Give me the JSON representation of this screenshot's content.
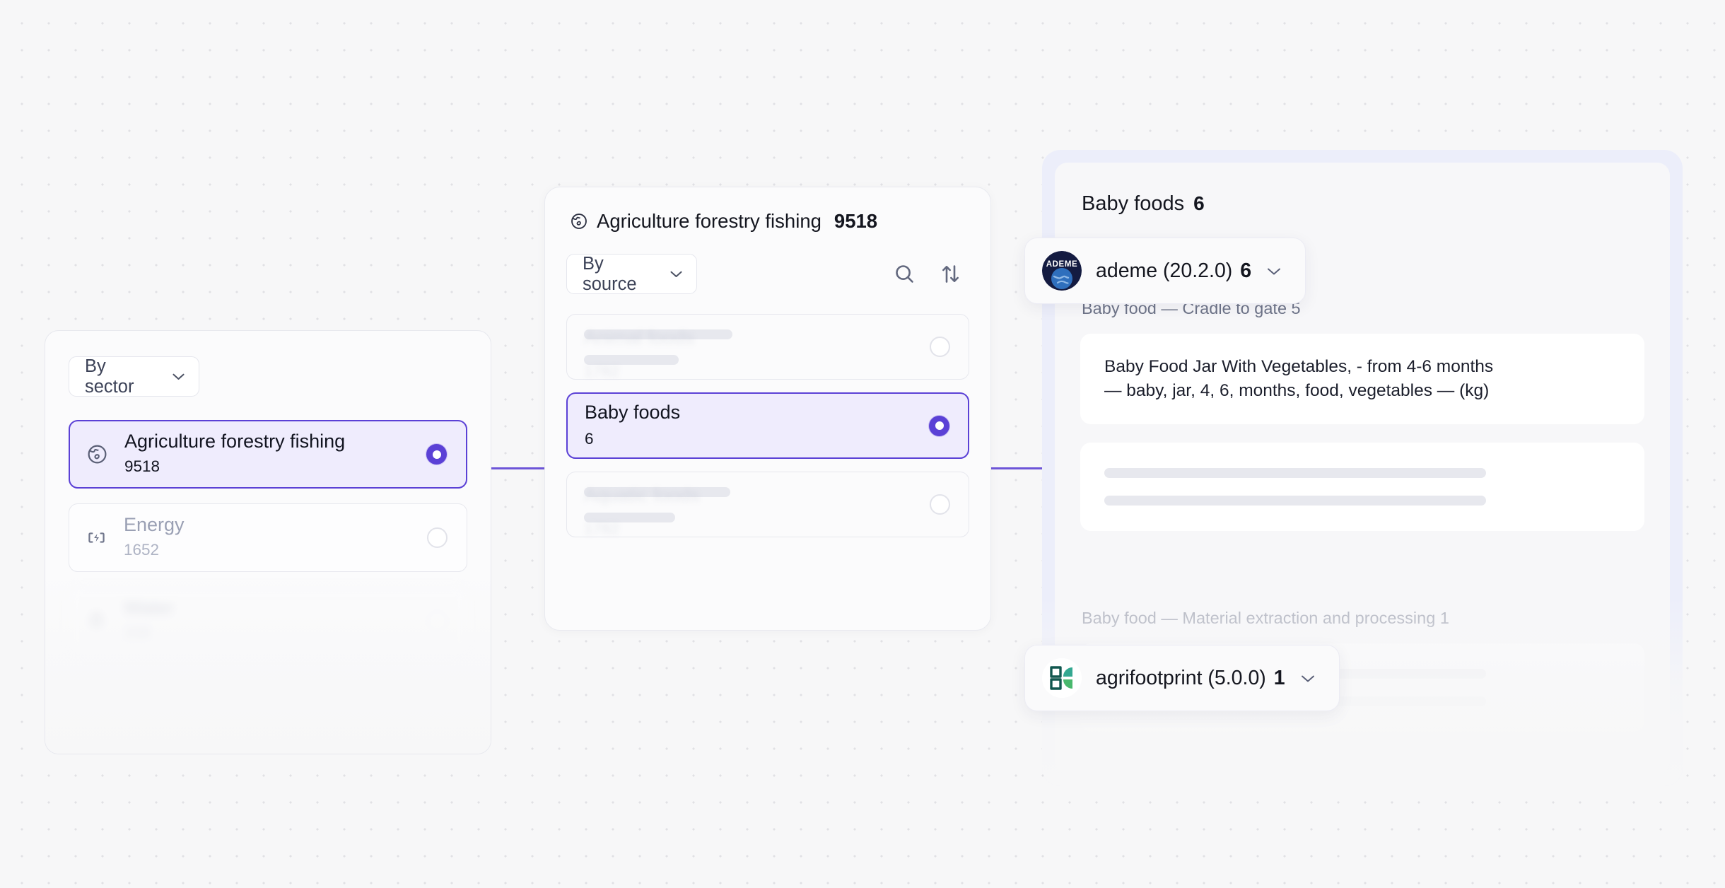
{
  "theme": {
    "accent": "#5b41d6",
    "connector": "#6d55d8",
    "selected_bg": "#efecfd",
    "page_bg": "#f7f7f8",
    "panel_bg": "#fbfbfc",
    "right_outer_bg": "#eceefa",
    "muted_text": "#9aa0b4",
    "skeleton": "#e7e8ee"
  },
  "left_panel": {
    "filter_select": {
      "label": "By sector",
      "icon": "chevron-down-icon"
    },
    "items": [
      {
        "name": "Agriculture forestry fishing",
        "count": "9518",
        "icon": "globe-icon",
        "selected": true,
        "state": "normal"
      },
      {
        "name": "Energy",
        "count": "1652",
        "icon": "battery-charging-icon",
        "selected": false,
        "state": "dim"
      },
      {
        "name": "Water",
        "count": "208",
        "icon": "water-drop-icon",
        "selected": false,
        "state": "blurred"
      }
    ]
  },
  "middle_panel": {
    "title": {
      "name": "Agriculture forestry fishing",
      "count": "9518",
      "icon": "globe-icon"
    },
    "filter_select": {
      "label": "By source",
      "icon": "chevron-down-icon"
    },
    "toolbar": {
      "search_icon": "search-icon",
      "sort_icon": "sort-arrows-icon"
    },
    "items": [
      {
        "name": "Animal foods",
        "count": "1782",
        "selected": false,
        "state": "skeleton"
      },
      {
        "name": "Baby foods",
        "count": "6",
        "selected": true,
        "state": "normal"
      },
      {
        "name": "Aquatic foods",
        "count": "1782",
        "selected": false,
        "state": "skeleton"
      }
    ]
  },
  "right_panel": {
    "header": {
      "name": "Baby foods",
      "count": "6"
    },
    "sources": [
      {
        "avatar": "ademe-logo-icon",
        "avatar_text": "ADEME",
        "label": "ademe (20.2.0)",
        "count": "6",
        "chevron": "chevron-down-icon",
        "expanded": true
      },
      {
        "avatar": "agrifootprint-logo-icon",
        "label": "agrifootprint (5.0.0)",
        "count": "1",
        "chevron": "chevron-down-icon",
        "expanded": false
      }
    ],
    "groups": [
      {
        "label": "Baby food — Cradle to gate 5",
        "results": [
          {
            "state": "normal",
            "line1": "Baby Food Jar With Vegetables, - from 4-6 months",
            "line2": "— baby, jar, 4, 6, months, food, vegetables — (kg)"
          },
          {
            "state": "skeleton"
          }
        ]
      },
      {
        "label": "Baby food — Material extraction and processing 1",
        "state": "faded",
        "results": [
          {
            "state": "skeleton"
          }
        ]
      }
    ]
  }
}
